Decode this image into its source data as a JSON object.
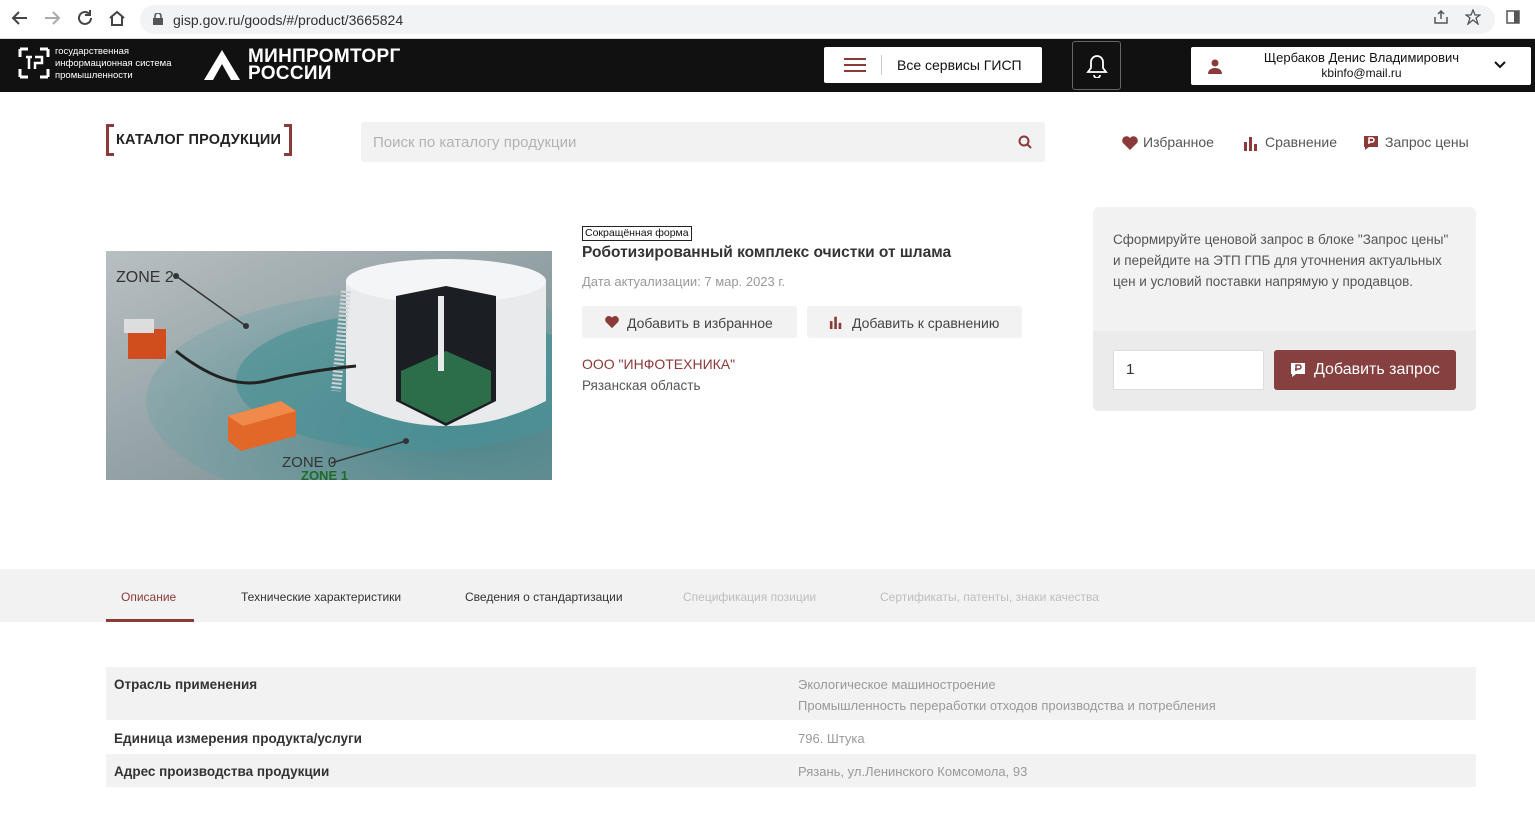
{
  "browser": {
    "url": "gisp.gov.ru/goods/#/product/3665824"
  },
  "header": {
    "gisp_logo_text": "государственная информационная система промышленности",
    "minprom_line1": "МИНПРОМТОРГ",
    "minprom_line2": "РОССИИ",
    "services_label": "Все сервисы ГИСП",
    "user_name": "Щербаков Денис Владимирович",
    "user_email": "kbinfo@mail.ru"
  },
  "catalog": {
    "title": "КАТАЛОГ ПРОДУКЦИИ",
    "search_placeholder": "Поиск по каталогу продукции",
    "links": {
      "favorites": "Избранное",
      "compare": "Сравнение",
      "price_request": "Запрос цены"
    }
  },
  "product": {
    "badge": "Сокращённая форма",
    "title": "Роботизированный комплекс очистки от шлама",
    "date": "Дата актуализации: 7 мар. 2023 г.",
    "add_favorite": "Добавить в избранное",
    "add_compare": "Добавить к сравнению",
    "company": "ООО \"ИНФОТЕХНИКА\"",
    "region": "Рязанская область",
    "image_labels": {
      "zone2": "ZONE 2",
      "zone0": "ZONE 0",
      "zone1": "ZONE 1"
    }
  },
  "request_panel": {
    "text": "Сформируйте ценовой запрос в блоке \"Запрос цены\" и перейдите на ЭТП ГПБ для уточнения актуальных цен и условий поставки напрямую у продавцов.",
    "quantity": "1",
    "button": "Добавить запрос"
  },
  "tabs": [
    {
      "label": "Описание"
    },
    {
      "label": "Технические характеристики"
    },
    {
      "label": "Сведения о стандартизации"
    },
    {
      "label": "Спецификация позиции"
    },
    {
      "label": "Сертификаты, патенты, знаки качества"
    }
  ],
  "properties": [
    {
      "key": "Отрасль применения",
      "values": [
        "Экологическое машиностроение",
        "Промышленность переработки отходов производства и потребления"
      ]
    },
    {
      "key": "Единица измерения продукта/услуги",
      "values": [
        "796. Штука"
      ]
    },
    {
      "key": "Адрес производства продукции",
      "values": [
        "Рязань, ул.Ленинского Комсомола, 93"
      ]
    }
  ],
  "colors": {
    "accent": "#8b3a3a",
    "button": "#874040",
    "header_bg": "#111111",
    "panel_bg": "#f2f2f3"
  }
}
